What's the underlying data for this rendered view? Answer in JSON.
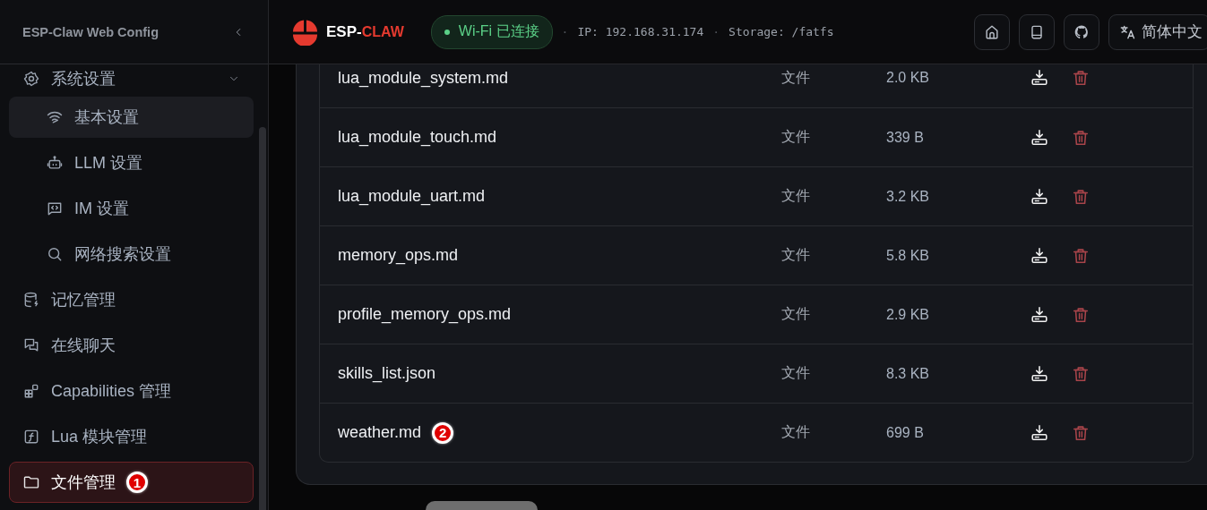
{
  "sidebar": {
    "title": "ESP-Claw Web Config",
    "items": [
      {
        "label": "系统设置",
        "expanded": true,
        "selected": false,
        "children": [
          {
            "label": "基本设置",
            "selected": false,
            "hovered": true
          },
          {
            "label": "LLM 设置",
            "selected": false,
            "hovered": false
          },
          {
            "label": "IM 设置",
            "selected": false,
            "hovered": false
          },
          {
            "label": "网络搜索设置",
            "selected": false,
            "hovered": false
          }
        ]
      },
      {
        "label": "记忆管理",
        "selected": false
      },
      {
        "label": "在线聊天",
        "selected": false
      },
      {
        "label": "Capabilities 管理",
        "selected": false
      },
      {
        "label": "Lua 模块管理",
        "selected": false
      },
      {
        "label": "文件管理",
        "selected": true,
        "marker": "1"
      }
    ]
  },
  "header": {
    "logo_prefix": "ESP-",
    "logo_suffix": "CLAW",
    "wifi_status": "Wi-Fi 已连接",
    "info": [
      {
        "kind": "sep",
        "text": "·"
      },
      {
        "kind": "text",
        "text": "IP: 192.168.31.174"
      },
      {
        "kind": "sep",
        "text": "·"
      },
      {
        "kind": "text",
        "text": "Storage: /fatfs"
      }
    ],
    "language": "简体中文"
  },
  "files": [
    {
      "name": "lua_module_system.md",
      "type": "文件",
      "size": "2.0 KB"
    },
    {
      "name": "lua_module_touch.md",
      "type": "文件",
      "size": "339 B"
    },
    {
      "name": "lua_module_uart.md",
      "type": "文件",
      "size": "3.2 KB"
    },
    {
      "name": "memory_ops.md",
      "type": "文件",
      "size": "5.8 KB"
    },
    {
      "name": "profile_memory_ops.md",
      "type": "文件",
      "size": "2.9 KB"
    },
    {
      "name": "skills_list.json",
      "type": "文件",
      "size": "8.3 KB"
    },
    {
      "name": "weather.md",
      "type": "文件",
      "size": "699 B",
      "marker": "2"
    }
  ]
}
